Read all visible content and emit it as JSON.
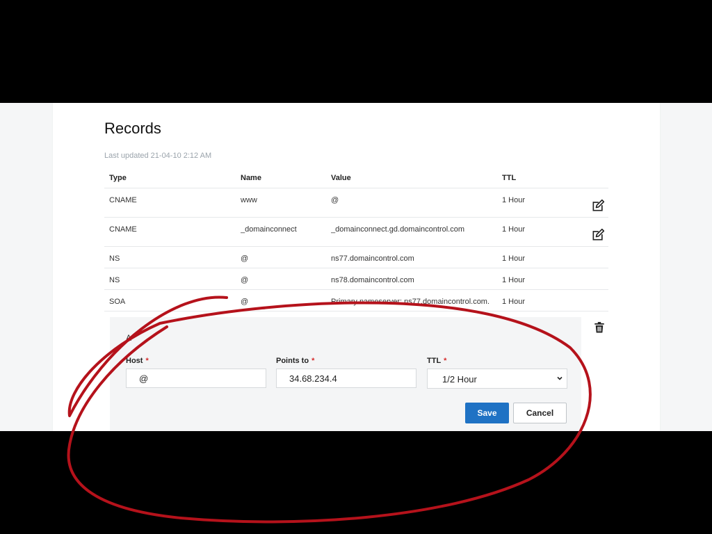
{
  "records": {
    "title": "Records",
    "last_updated": "Last updated 21-04-10 2:12 AM",
    "columns": {
      "type": "Type",
      "name": "Name",
      "value": "Value",
      "ttl": "TTL"
    },
    "rows": [
      {
        "type": "CNAME",
        "name": "www",
        "value": "@",
        "ttl": "1 Hour",
        "editable": true
      },
      {
        "type": "CNAME",
        "name": "_domainconnect",
        "value": "_domainconnect.gd.domaincontrol.com",
        "ttl": "1 Hour",
        "editable": true
      },
      {
        "type": "NS",
        "name": "@",
        "value": "ns77.domaincontrol.com",
        "ttl": "1 Hour",
        "editable": false
      },
      {
        "type": "NS",
        "name": "@",
        "value": "ns78.domaincontrol.com",
        "ttl": "1 Hour",
        "editable": false
      },
      {
        "type": "SOA",
        "name": "@",
        "value": "Primary nameserver: ns77.domaincontrol.com.",
        "ttl": "1 Hour",
        "editable": false
      }
    ]
  },
  "editor": {
    "record_type": "A",
    "host_label": "Host",
    "host_value": "@",
    "points_to_label": "Points to",
    "points_to_value": "34.68.234.4",
    "ttl_label": "TTL",
    "ttl_value": "1/2 Hour",
    "required_mark": "*",
    "save_label": "Save",
    "cancel_label": "Cancel"
  },
  "icons": {
    "edit": "edit-icon",
    "delete": "trash-icon",
    "dropdown": "chevron-down-icon"
  },
  "colors": {
    "primary_button": "#1f72c4",
    "required": "#d52b2b",
    "annotation": "#b5121b",
    "letterbox": "#000000"
  }
}
